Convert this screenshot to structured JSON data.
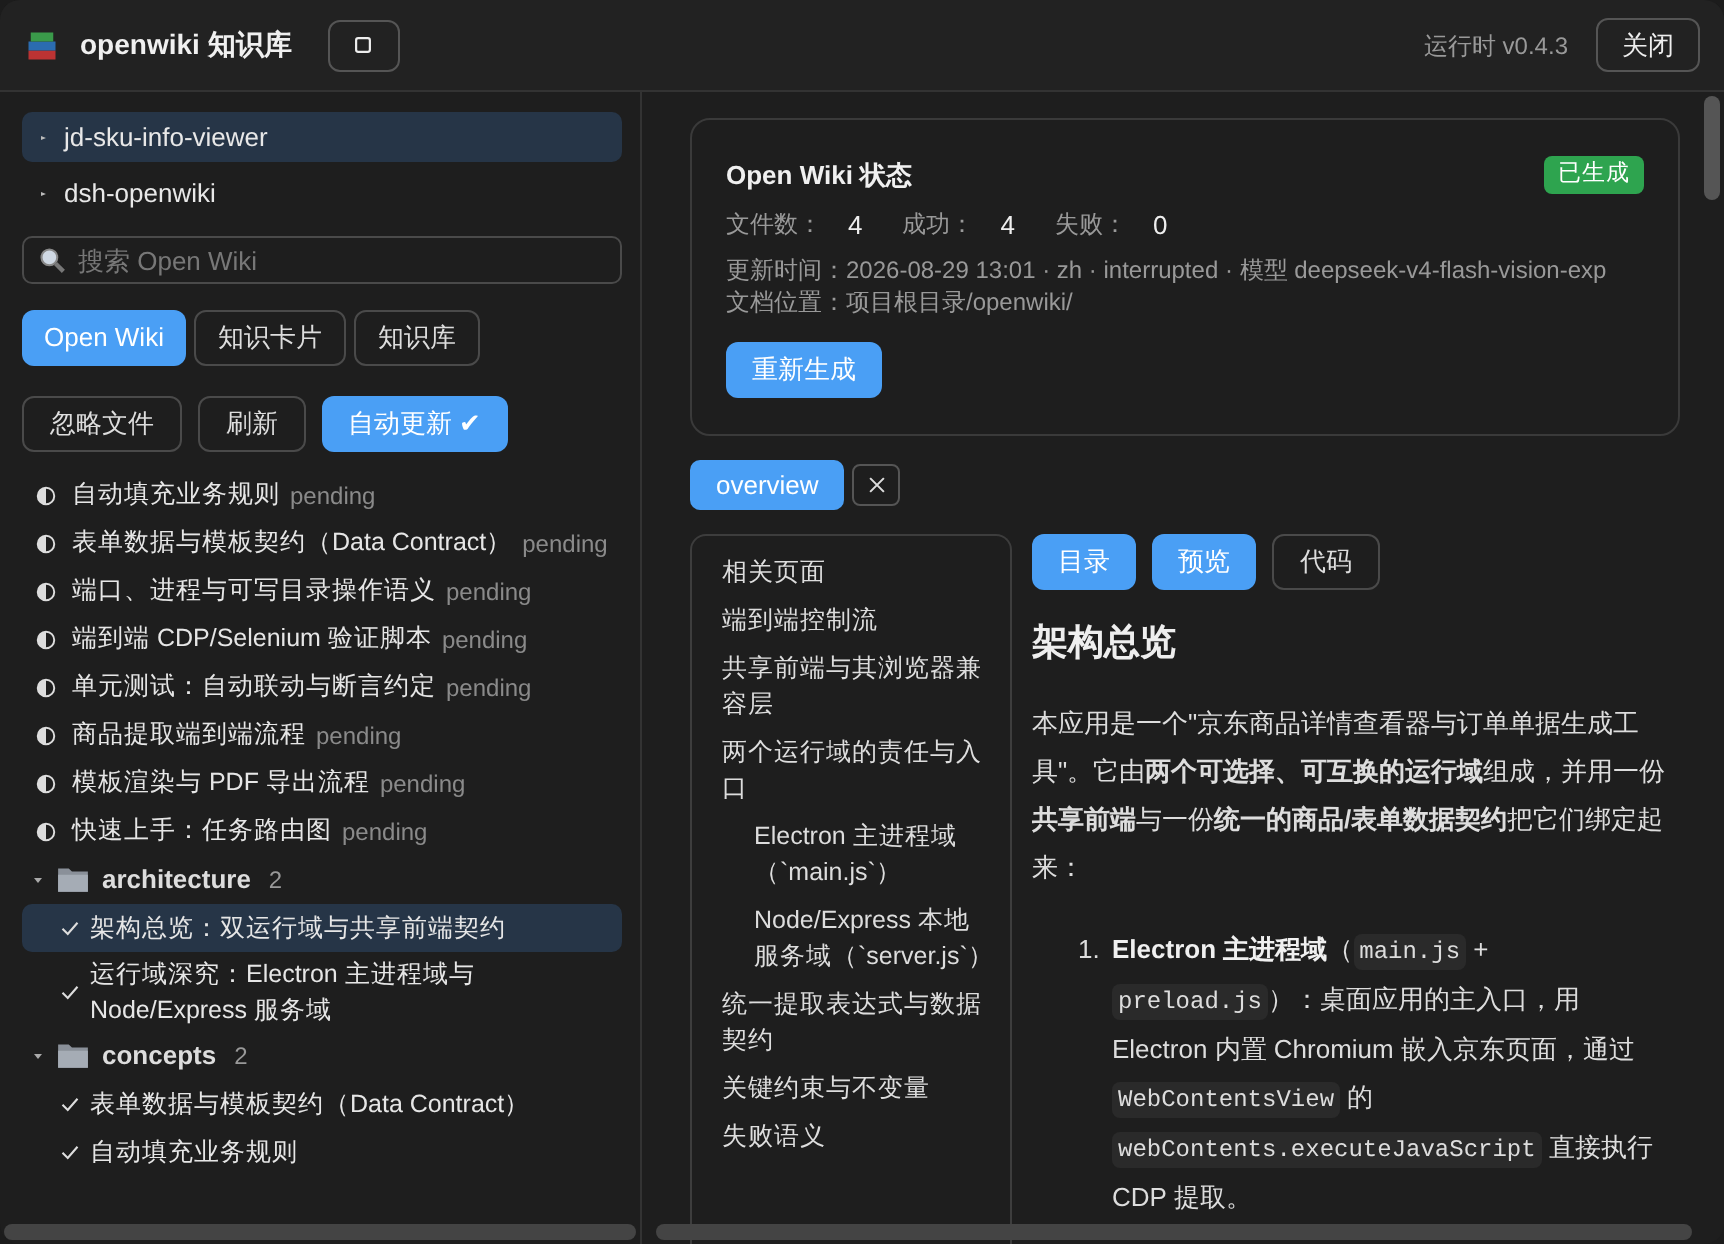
{
  "window": {
    "title": "openwiki 知识库",
    "version": "运行时 v0.4.3",
    "close_label": "关闭"
  },
  "sidebar": {
    "projects": [
      {
        "name": "jd-sku-info-viewer",
        "selected": true
      },
      {
        "name": "dsh-openwiki",
        "selected": false
      }
    ],
    "search": {
      "placeholder": "搜索 Open Wiki"
    },
    "tabs": [
      {
        "label": "Open Wiki",
        "selected": true
      },
      {
        "label": "知识卡片",
        "selected": false
      },
      {
        "label": "知识库",
        "selected": false
      }
    ],
    "actions": [
      {
        "label": "忽略文件",
        "on": false
      },
      {
        "label": "刷新",
        "on": false
      },
      {
        "label": "自动更新 ✔",
        "on": true
      }
    ],
    "items": [
      {
        "kind": "page",
        "title": "自动填充业务规则",
        "status": "pending",
        "generated": false,
        "selected": false
      },
      {
        "kind": "page",
        "title": "表单数据与模板契约（Data Contract）",
        "status": "pending",
        "generated": false,
        "selected": false
      },
      {
        "kind": "page",
        "title": "端口、进程与可写目录操作语义",
        "status": "pending",
        "generated": false,
        "selected": false
      },
      {
        "kind": "page",
        "title": "端到端 CDP/Selenium 验证脚本",
        "status": "pending",
        "generated": false,
        "selected": false
      },
      {
        "kind": "page",
        "title": "单元测试：自动联动与断言约定",
        "status": "pending",
        "generated": false,
        "selected": false
      },
      {
        "kind": "page",
        "title": "商品提取端到端流程",
        "status": "pending",
        "generated": false,
        "selected": false
      },
      {
        "kind": "page",
        "title": "模板渲染与 PDF 导出流程",
        "status": "pending",
        "generated": false,
        "selected": false
      },
      {
        "kind": "page",
        "title": "快速上手：任务路由图",
        "status": "pending",
        "generated": false,
        "selected": false
      },
      {
        "kind": "group",
        "name": "architecture",
        "count": "2",
        "expanded": true,
        "children": [
          {
            "title": "架构总览：双运行域与共享前端契约",
            "generated": true,
            "selected": true
          },
          {
            "title": "运行域深究：Electron 主进程域与 Node/Express 服务域",
            "generated": true,
            "selected": false
          }
        ]
      },
      {
        "kind": "group",
        "name": "concepts",
        "count": "2",
        "expanded": true,
        "children": [
          {
            "title": "表单数据与模板契约（Data Contract）",
            "generated": true,
            "selected": false
          },
          {
            "title": "自动填充业务规则",
            "generated": true,
            "selected": false
          }
        ]
      }
    ]
  },
  "status_card": {
    "title": "Open Wiki 状态",
    "badge": "已生成",
    "stats": [
      {
        "label": "文件数：",
        "value": "4"
      },
      {
        "label": "成功：",
        "value": "4"
      },
      {
        "label": "失败：",
        "value": "0"
      }
    ],
    "updated": "更新时间：2026-08-29 13:01 · zh · interrupted · 模型 deepseek-v4-flash-vision-exp",
    "location": "文档位置：项目根目录/openwiki/",
    "button": "重新生成"
  },
  "doc_tabs": [
    {
      "label": "overview",
      "selected": true
    }
  ],
  "toc": [
    {
      "title": "相关页面"
    },
    {
      "title": "端到端控制流"
    },
    {
      "title": "共享前端与其浏览器兼容层"
    },
    {
      "title": "两个运行域的责任与入口",
      "children": [
        {
          "title": "Electron 主进程域（`main.js`）"
        },
        {
          "title": "Node/Express 本地服务域（`server.js`）"
        }
      ]
    },
    {
      "title": "统一提取表达式与数据契约"
    },
    {
      "title": "关键约束与不变量"
    },
    {
      "title": "失败语义"
    }
  ],
  "view_modes": [
    {
      "label": "目录",
      "selected": true
    },
    {
      "label": "预览",
      "selected": true
    },
    {
      "label": "代码",
      "selected": false
    }
  ],
  "document": {
    "heading": "架构总览",
    "paragraph": "本应用是一个\"京东商品详情查看器与订单单据生成工具\"。它由**两个可选择、可互换的运行域**组成，并用一份**共享前端**与一份**统一的商品/表单数据契约**把它们绑定起来：",
    "list": [
      {
        "number": "1.",
        "segments": [
          {
            "kind": "bold",
            "text": "Electron 主进程域"
          },
          {
            "kind": "text",
            "text": "（"
          },
          {
            "kind": "code",
            "text": "main.js"
          },
          {
            "kind": "text",
            "text": " + "
          },
          {
            "kind": "code",
            "text": "preload.js"
          },
          {
            "kind": "text",
            "text": "）：桌面应用的主入口，用 Electron 内置 Chromium 嵌入京东页面，通过 "
          },
          {
            "kind": "code",
            "text": "WebContentsView"
          },
          {
            "kind": "text",
            "text": " 的 "
          },
          {
            "kind": "code",
            "text": "webContents.executeJavaScript"
          },
          {
            "kind": "text",
            "text": " 直接执行 CDP 提取。"
          }
        ]
      }
    ]
  }
}
